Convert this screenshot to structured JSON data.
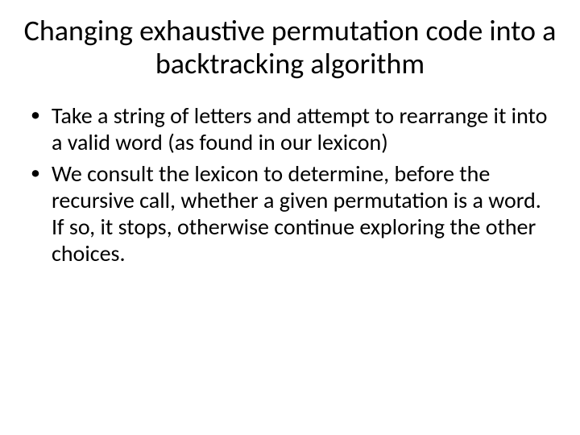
{
  "title": "Changing exhaustive permutation code into a backtracking algorithm",
  "bullets": [
    "Take a string of letters and attempt to rearrange it into a valid word (as found in our lexicon)",
    "We consult the lexicon to determine, before the recursive call, whether a given permutation is a word. If so, it stops, otherwise continue exploring the other choices."
  ]
}
